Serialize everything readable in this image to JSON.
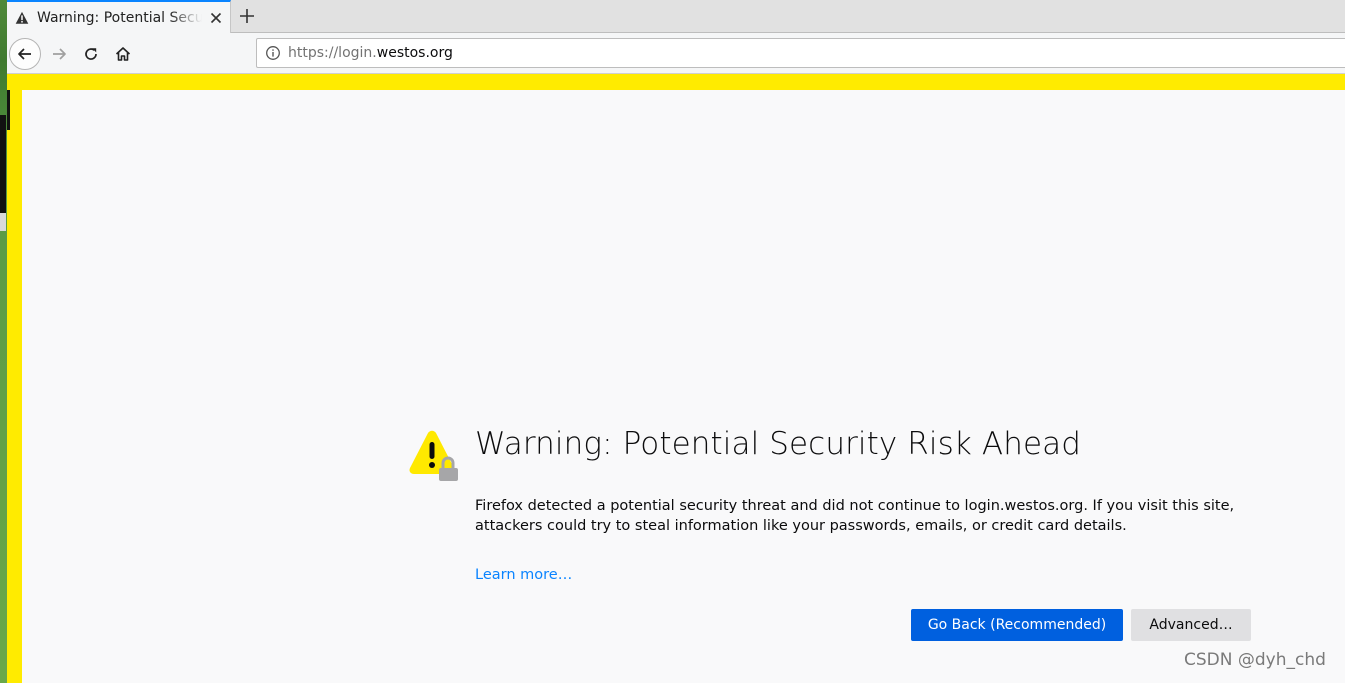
{
  "tab": {
    "title": "Warning: Potential Security Risk Ahead",
    "icon": "warning-icon"
  },
  "navbar": {
    "url_prefix": "https://login.",
    "url_host": "westos.org"
  },
  "page": {
    "title": "Warning: Potential Security Risk Ahead",
    "description": "Firefox detected a potential security threat and did not continue to login.westos.org. If you visit this site, attackers could try to steal information like your passwords, emails, or credit card details.",
    "learn_more": "Learn more…",
    "go_back_label": "Go Back (Recommended)",
    "advanced_label": "Advanced…"
  },
  "watermark": "CSDN @dyh_chd",
  "colors": {
    "highlight": "#ffeb00",
    "primary_button": "#0060df",
    "link": "#0a84ff",
    "warning_icon": "#ffe900"
  }
}
